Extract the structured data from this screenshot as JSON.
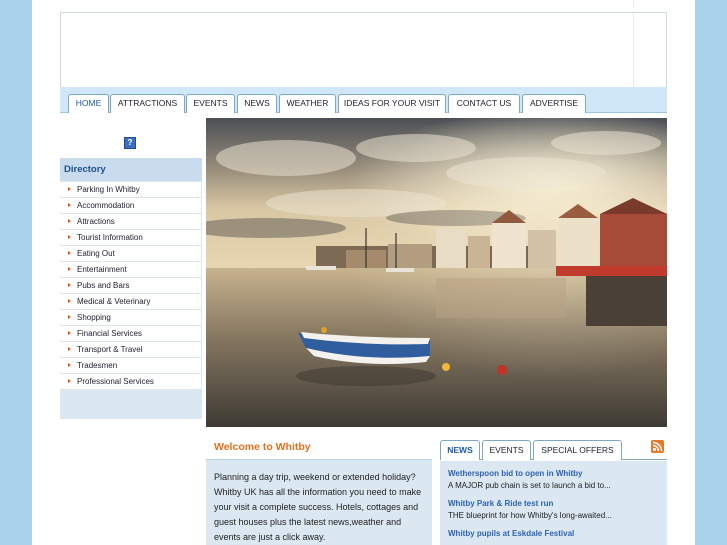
{
  "nav": {
    "tabs": [
      {
        "label": "HOME",
        "active": true
      },
      {
        "label": "ATTRACTIONS"
      },
      {
        "label": "EVENTS"
      },
      {
        "label": "NEWS"
      },
      {
        "label": "WEATHER"
      },
      {
        "label": "IDEAS FOR YOUR VISIT"
      },
      {
        "label": "CONTACT US"
      },
      {
        "label": "ADVERTISE"
      }
    ]
  },
  "help_icon": {
    "glyph": "?"
  },
  "directory": {
    "title": "Directory",
    "items": [
      "Parking In Whitby",
      "Accommodation",
      "Attractions",
      "Tourist Information",
      "Eating Out",
      "Entertainment",
      "Pubs and Bars",
      "Medical & Veterinary",
      "Shopping",
      "Financial Services",
      "Transport & Travel",
      "Tradesmen",
      "Professional Services"
    ]
  },
  "welcome": {
    "title": "Welcome to Whitby",
    "body": "Planning a day trip, weekend or extended holiday?   Whitby UK has all the information you need to make your visit a complete success. Hotels, cottages and guest houses plus the latest news,weather and events are just a click away."
  },
  "news_tabs": [
    {
      "label": "NEWS",
      "active": true
    },
    {
      "label": "EVENTS"
    },
    {
      "label": "SPECIAL OFFERS"
    }
  ],
  "news": [
    {
      "title": "Wetherspoon bid to open in Whitby",
      "snippet": "A MAJOR pub chain is set to launch a bid to..."
    },
    {
      "title": "Whitby Park & Ride test run",
      "snippet": "THE blueprint for how Whitby's long-awaited..."
    },
    {
      "title": "Whitby pupils at Eskdale Festival",
      "snippet": ""
    }
  ],
  "colors": {
    "accent": "#e07020",
    "link": "#2f63b3",
    "background": "#a9d3ea"
  }
}
